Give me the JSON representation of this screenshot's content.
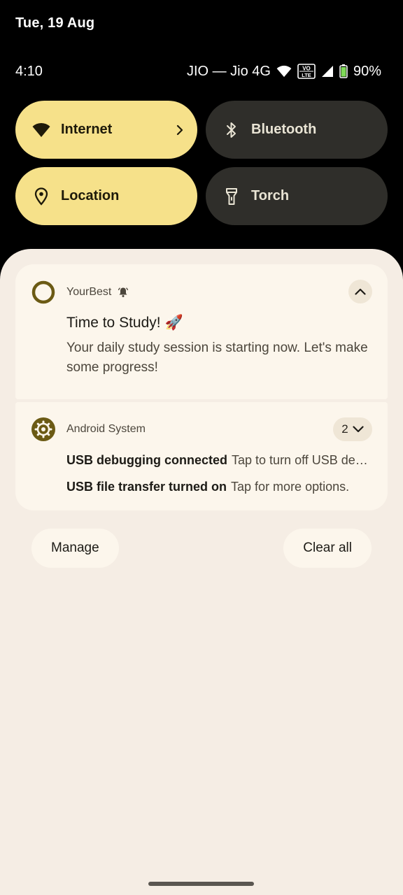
{
  "date": "Tue, 19 Aug",
  "status_bar": {
    "time": "4:10",
    "carrier": "JIO — Jio 4G",
    "battery": "90%",
    "icons": [
      "wifi-icon",
      "volte-icon",
      "signal-icon",
      "battery-icon"
    ]
  },
  "quick_tiles": [
    {
      "label": "Internet",
      "icon": "wifi-icon",
      "state": "on"
    },
    {
      "label": "Bluetooth",
      "icon": "bluetooth-icon",
      "state": "off"
    },
    {
      "label": "Location",
      "icon": "location-pin-icon",
      "state": "on"
    },
    {
      "label": "Torch",
      "icon": "torch-icon",
      "state": "off"
    }
  ],
  "notifications": [
    {
      "app": "YourBest",
      "title": "Time to Study! 🚀",
      "text": "Your daily study session is starting now. Let's make some progress!"
    },
    {
      "app": "Android System",
      "count": "2",
      "items": [
        {
          "title": "USB debugging connected",
          "text": "Tap to turn off USB debugging"
        },
        {
          "title": "USB file transfer turned on",
          "text": "Tap for more options."
        }
      ]
    }
  ],
  "actions": {
    "manage": "Manage",
    "clear_all": "Clear all"
  },
  "colors": {
    "tile_on": "#f6e18a",
    "tile_off": "#2f2e2a",
    "sheet": "#f5ede4",
    "card": "#fcf6ec",
    "accent_icon": "#6b5a14"
  }
}
